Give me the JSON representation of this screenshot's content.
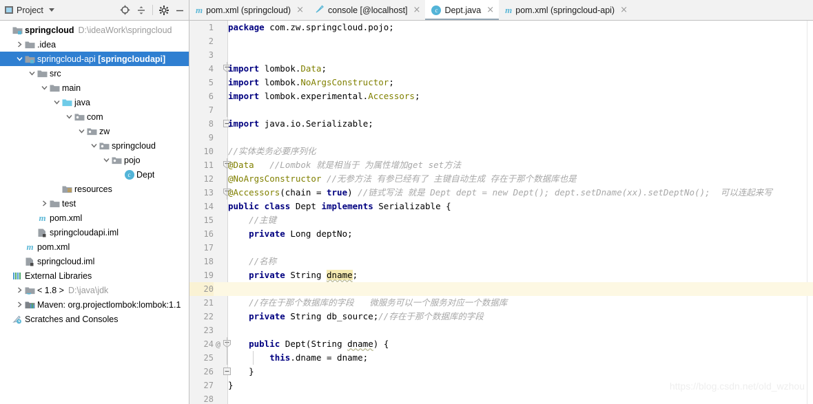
{
  "project_panel": {
    "title": "Project",
    "icon": "project-panel-icon",
    "dropdown_icon": "chevron-down-icon",
    "tools": [
      {
        "name": "locate-target-icon",
        "label": "Select Opened File"
      },
      {
        "name": "collapse-all-icon",
        "label": "Collapse All"
      },
      {
        "name": "gear-icon",
        "label": "Settings"
      },
      {
        "name": "minimize-icon",
        "label": "Hide"
      }
    ]
  },
  "tabs": [
    {
      "label": "pom.xml (springcloud)",
      "icon": "maven-icon",
      "active": false,
      "close_icon": "close-icon"
    },
    {
      "label": "console [@localhost]",
      "icon": "console-icon",
      "active": false,
      "close_icon": "close-icon"
    },
    {
      "label": "Dept.java",
      "icon": "java-class-icon",
      "active": true,
      "close_icon": "close-icon"
    },
    {
      "label": "pom.xml (springcloud-api)",
      "icon": "maven-icon",
      "active": false,
      "close_icon": "close-icon"
    }
  ],
  "tree": [
    {
      "depth": 0,
      "arrow": "none",
      "icon": "module-icon",
      "label": "springcloud",
      "bold": true,
      "path": "D:\\ideaWork\\springcloud",
      "selected": false
    },
    {
      "depth": 1,
      "arrow": "right",
      "icon": "folder-icon",
      "label": ".idea",
      "bold": false,
      "path": "",
      "selected": false
    },
    {
      "depth": 1,
      "arrow": "down",
      "icon": "module-icon",
      "label": "springcloud-api ",
      "bold_suffix": "[springcloudapi]",
      "path": "",
      "selected": true
    },
    {
      "depth": 2,
      "arrow": "down",
      "icon": "folder-icon",
      "label": "src",
      "bold": false,
      "path": "",
      "selected": false
    },
    {
      "depth": 3,
      "arrow": "down",
      "icon": "folder-icon",
      "label": "main",
      "bold": false,
      "path": "",
      "selected": false
    },
    {
      "depth": 4,
      "arrow": "down",
      "icon": "source-root-icon",
      "label": "java",
      "bold": false,
      "path": "",
      "selected": false
    },
    {
      "depth": 5,
      "arrow": "down",
      "icon": "package-icon",
      "label": "com",
      "bold": false,
      "path": "",
      "selected": false
    },
    {
      "depth": 6,
      "arrow": "down",
      "icon": "package-icon",
      "label": "zw",
      "bold": false,
      "path": "",
      "selected": false
    },
    {
      "depth": 7,
      "arrow": "down",
      "icon": "package-icon",
      "label": "springcloud",
      "bold": false,
      "path": "",
      "selected": false
    },
    {
      "depth": 8,
      "arrow": "down",
      "icon": "package-icon",
      "label": "pojo",
      "bold": false,
      "path": "",
      "selected": false
    },
    {
      "depth": 9,
      "arrow": "none",
      "icon": "java-class-icon",
      "label": "Dept",
      "bold": false,
      "path": "",
      "selected": false
    },
    {
      "depth": 4,
      "arrow": "none",
      "icon": "resources-icon",
      "label": "resources",
      "bold": false,
      "path": "",
      "selected": false
    },
    {
      "depth": 3,
      "arrow": "right",
      "icon": "folder-icon",
      "label": "test",
      "bold": false,
      "path": "",
      "selected": false
    },
    {
      "depth": 2,
      "arrow": "none",
      "icon": "maven-icon",
      "label": "pom.xml",
      "bold": false,
      "path": "",
      "selected": false
    },
    {
      "depth": 2,
      "arrow": "none",
      "icon": "iml-icon",
      "label": "springcloudapi.iml",
      "bold": false,
      "path": "",
      "selected": false
    },
    {
      "depth": 1,
      "arrow": "none",
      "icon": "maven-icon",
      "label": "pom.xml",
      "bold": false,
      "path": "",
      "selected": false
    },
    {
      "depth": 1,
      "arrow": "none",
      "icon": "iml-icon",
      "label": "springcloud.iml",
      "bold": false,
      "path": "",
      "selected": false
    },
    {
      "depth": 0,
      "arrow": "none",
      "icon": "libraries-icon",
      "label": "External Libraries",
      "bold": false,
      "path": "",
      "selected": false
    },
    {
      "depth": 1,
      "arrow": "right",
      "icon": "jdk-icon",
      "label": "< 1.8 >",
      "bold": false,
      "path": "D:\\java\\jdk",
      "selected": false
    },
    {
      "depth": 1,
      "arrow": "right",
      "icon": "maven-lib-icon",
      "label": "Maven: org.projectlombok:lombok:1.1",
      "bold": false,
      "path": "",
      "selected": false
    },
    {
      "depth": 0,
      "arrow": "none",
      "icon": "scratches-icon",
      "label": "Scratches and Consoles",
      "bold": false,
      "path": "",
      "selected": false
    }
  ],
  "editor": {
    "file": "Dept.java",
    "caret_line": 20,
    "lines": [
      {
        "n": 1,
        "fold": "none",
        "at": false,
        "tokens": [
          {
            "t": "package ",
            "c": "kw"
          },
          {
            "t": "com.zw.springcloud.pojo;",
            "c": "pln"
          }
        ]
      },
      {
        "n": 2,
        "fold": "none",
        "at": false,
        "tokens": []
      },
      {
        "n": 3,
        "fold": "none",
        "at": false,
        "tokens": []
      },
      {
        "n": 4,
        "fold": "start",
        "at": false,
        "tokens": [
          {
            "t": "import ",
            "c": "kw"
          },
          {
            "t": "lombok.",
            "c": "pln"
          },
          {
            "t": "Data",
            "c": "typ"
          },
          {
            "t": ";",
            "c": "pln"
          }
        ]
      },
      {
        "n": 5,
        "fold": "mid",
        "at": false,
        "tokens": [
          {
            "t": "import ",
            "c": "kw"
          },
          {
            "t": "lombok.",
            "c": "pln"
          },
          {
            "t": "NoArgsConstructor",
            "c": "typ"
          },
          {
            "t": ";",
            "c": "pln"
          }
        ]
      },
      {
        "n": 6,
        "fold": "mid",
        "at": false,
        "tokens": [
          {
            "t": "import ",
            "c": "kw"
          },
          {
            "t": "lombok.experimental.",
            "c": "pln"
          },
          {
            "t": "Accessors",
            "c": "typ"
          },
          {
            "t": ";",
            "c": "pln"
          }
        ]
      },
      {
        "n": 7,
        "fold": "mid",
        "at": false,
        "tokens": []
      },
      {
        "n": 8,
        "fold": "end",
        "at": false,
        "tokens": [
          {
            "t": "import ",
            "c": "kw"
          },
          {
            "t": "java.io.",
            "c": "pln"
          },
          {
            "t": "Serializable",
            "c": "pln"
          },
          {
            "t": ";",
            "c": "pln"
          }
        ]
      },
      {
        "n": 9,
        "fold": "none",
        "at": false,
        "tokens": []
      },
      {
        "n": 10,
        "fold": "none",
        "at": false,
        "tokens": [
          {
            "t": "//实体类务必要序列化",
            "c": "cmt"
          }
        ]
      },
      {
        "n": 11,
        "fold": "start",
        "at": false,
        "tokens": [
          {
            "t": "@Data",
            "c": "ann"
          },
          {
            "t": "   //Lombok 就是相当于 为属性增加get set方法",
            "c": "cmt"
          }
        ]
      },
      {
        "n": 12,
        "fold": "mid",
        "at": false,
        "tokens": [
          {
            "t": "@NoArgsConstructor",
            "c": "ann"
          },
          {
            "t": " //无参方法 有参已经有了 主键自动生成 存在于那个数据库也是",
            "c": "cmt"
          }
        ]
      },
      {
        "n": 13,
        "fold": "start",
        "at": false,
        "tokens": [
          {
            "t": "@Accessors",
            "c": "ann"
          },
          {
            "t": "(chain = ",
            "c": "pln"
          },
          {
            "t": "true",
            "c": "kw"
          },
          {
            "t": ") ",
            "c": "pln"
          },
          {
            "t": "//链式写法 就是 Dept dept = new Dept(); dept.setDname(xx).setDeptNo();  可以连起来写",
            "c": "cmt"
          }
        ]
      },
      {
        "n": 14,
        "fold": "none",
        "at": false,
        "tokens": [
          {
            "t": "public class ",
            "c": "kw"
          },
          {
            "t": "Dept ",
            "c": "pln"
          },
          {
            "t": "implements ",
            "c": "kw"
          },
          {
            "t": "Serializable {",
            "c": "pln"
          }
        ]
      },
      {
        "n": 15,
        "fold": "none",
        "at": false,
        "tokens": [
          {
            "t": "    //主键",
            "c": "cmt"
          }
        ]
      },
      {
        "n": 16,
        "fold": "none",
        "at": false,
        "tokens": [
          {
            "t": "    ",
            "c": "pln"
          },
          {
            "t": "private ",
            "c": "kw"
          },
          {
            "t": "Long deptNo;",
            "c": "pln"
          }
        ]
      },
      {
        "n": 17,
        "fold": "none",
        "at": false,
        "tokens": []
      },
      {
        "n": 18,
        "fold": "none",
        "at": false,
        "tokens": [
          {
            "t": "    //名称",
            "c": "cmt"
          }
        ]
      },
      {
        "n": 19,
        "fold": "none",
        "at": false,
        "tokens": [
          {
            "t": "    ",
            "c": "pln"
          },
          {
            "t": "private ",
            "c": "kw"
          },
          {
            "t": "String ",
            "c": "pln"
          },
          {
            "t": "dname",
            "c": "hl sq"
          },
          {
            "t": ";",
            "c": "pln"
          }
        ]
      },
      {
        "n": 20,
        "fold": "none",
        "at": false,
        "tokens": []
      },
      {
        "n": 21,
        "fold": "none",
        "at": false,
        "tokens": [
          {
            "t": "    //存在于那个数据库的字段   微服务可以一个服务对应一个数据库",
            "c": "cmt"
          }
        ]
      },
      {
        "n": 22,
        "fold": "none",
        "at": false,
        "tokens": [
          {
            "t": "    ",
            "c": "pln"
          },
          {
            "t": "private ",
            "c": "kw"
          },
          {
            "t": "String db_source;",
            "c": "pln"
          },
          {
            "t": "//存在于那个数据库的字段",
            "c": "cmt"
          }
        ]
      },
      {
        "n": 23,
        "fold": "none",
        "at": false,
        "tokens": []
      },
      {
        "n": 24,
        "fold": "start",
        "at": true,
        "tokens": [
          {
            "t": "    ",
            "c": "pln"
          },
          {
            "t": "public ",
            "c": "kw"
          },
          {
            "t": "Dept(",
            "c": "pln"
          },
          {
            "t": "String ",
            "c": "pln"
          },
          {
            "t": "dname",
            "c": "sq"
          },
          {
            "t": ") {",
            "c": "pln"
          }
        ]
      },
      {
        "n": 25,
        "fold": "bar",
        "at": false,
        "tokens": [
          {
            "t": "        ",
            "c": "pln"
          },
          {
            "t": "this",
            "c": "kw"
          },
          {
            "t": ".dname = dname;",
            "c": "pln"
          }
        ]
      },
      {
        "n": 26,
        "fold": "end",
        "at": false,
        "tokens": [
          {
            "t": "    }",
            "c": "pln"
          }
        ]
      },
      {
        "n": 27,
        "fold": "none",
        "at": false,
        "tokens": [
          {
            "t": "}",
            "c": "pln"
          }
        ]
      },
      {
        "n": 28,
        "fold": "none",
        "at": false,
        "tokens": []
      }
    ]
  },
  "watermark": "https://blog.csdn.net/old_wzhou",
  "colors": {
    "selection_blue": "#2f7fd1",
    "keyword_navy": "#000080",
    "annotation_olive": "#808000",
    "comment_grey": "#a8a8a8",
    "caret_line": "#fdf8e3",
    "highlight_yellow": "#f5eab0",
    "gutter_bg": "#f2f2f2",
    "tab_active_underline": "#93a6b5"
  }
}
